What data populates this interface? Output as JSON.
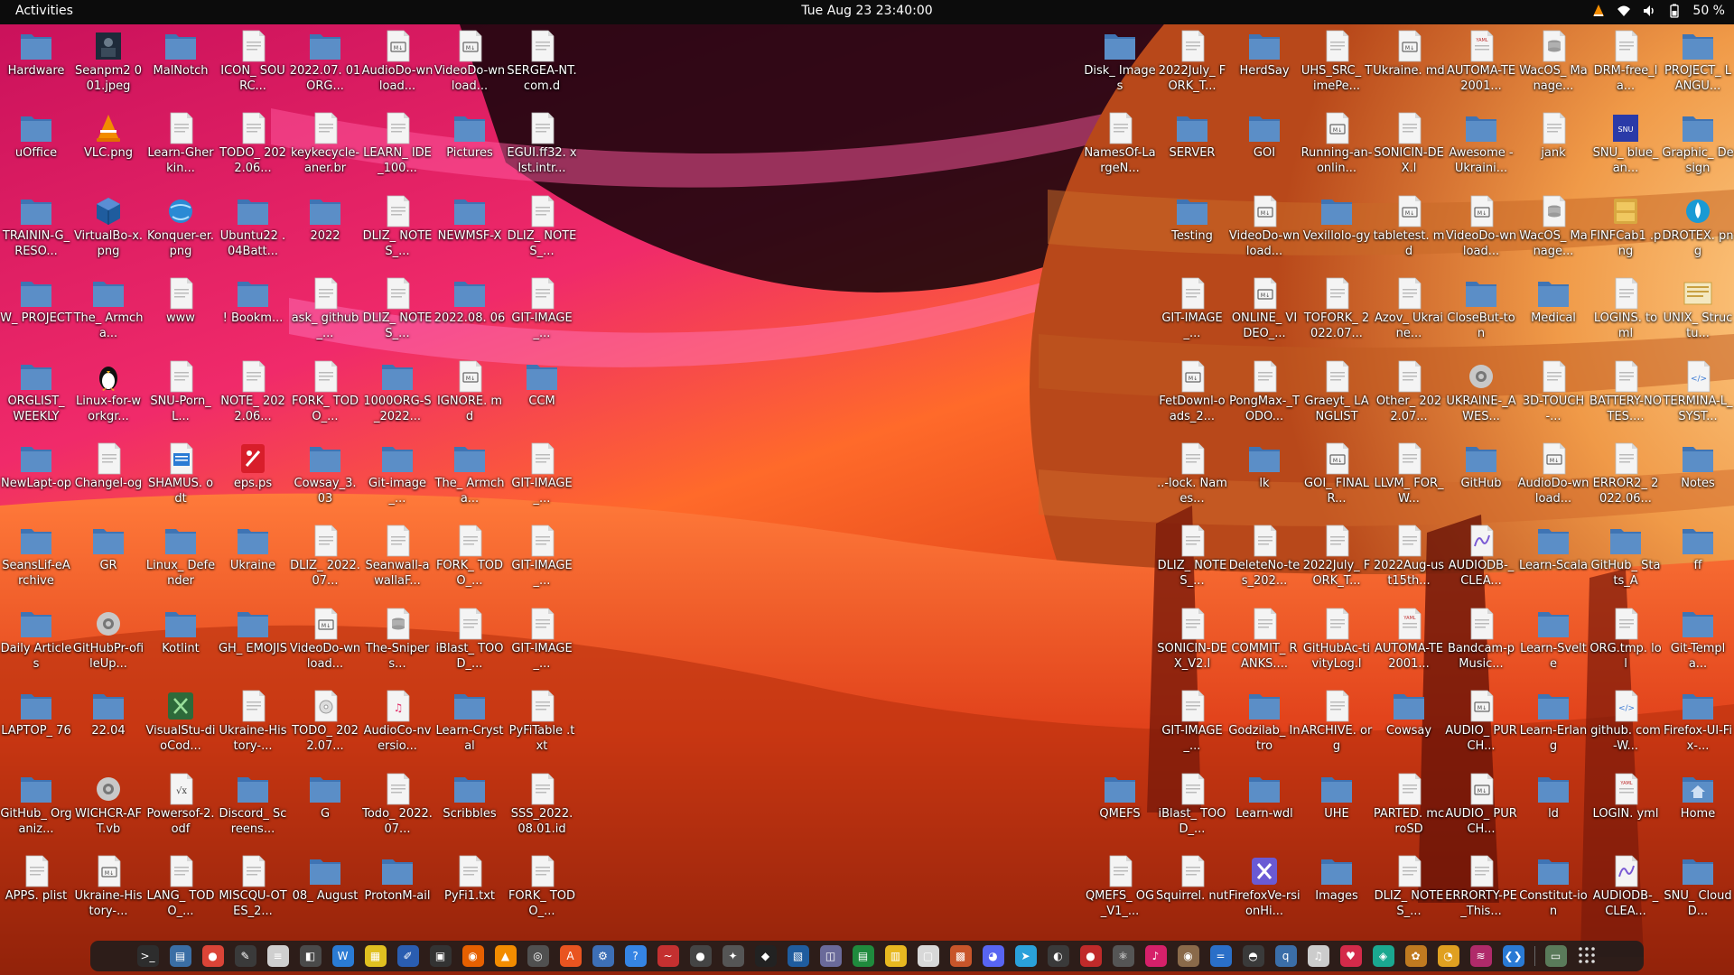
{
  "topbar": {
    "activities": "Activities",
    "clock": "Tue Aug 23  23:40:00",
    "battery": "50 %",
    "icons": [
      "vlc-tray-icon",
      "wifi-icon",
      "volume-icon",
      "battery-icon"
    ]
  },
  "colors": {
    "topbar_bg": "#0c0c0c",
    "folder": "#5b8ec7",
    "file": "#f4f4f4",
    "wallpaper_pink": "#e8146e",
    "wallpaper_orange": "#ff5a14",
    "planet": "#f09a48"
  },
  "left_icons": [
    {
      "label": "Hardware",
      "icon": "folder"
    },
    {
      "label": "uOffice",
      "icon": "folder"
    },
    {
      "label": "TRAININ-G_RESO...",
      "icon": "folder"
    },
    {
      "label": "W_ PROJECT",
      "icon": "folder"
    },
    {
      "label": "ORGLIST_ WEEKLY",
      "icon": "folder"
    },
    {
      "label": "NewLapt-op",
      "icon": "folder"
    },
    {
      "label": "SeansLif-eArchive",
      "icon": "folder"
    },
    {
      "label": "Daily Articles",
      "icon": "folder"
    },
    {
      "label": "LAPTOP_ 76",
      "icon": "folder"
    },
    {
      "label": "GitHub_ Organiz...",
      "icon": "folder"
    },
    {
      "label": "APPS. plist",
      "icon": "file"
    },
    {
      "label": "Seanpm2 001.jpeg",
      "icon": "image"
    },
    {
      "label": "VLC.png",
      "icon": "vlc"
    },
    {
      "label": "VirtualBo-x.png",
      "icon": "cube"
    },
    {
      "label": "The_ Armcha...",
      "icon": "folder"
    },
    {
      "label": "Linux-for-workgr...",
      "icon": "tux"
    },
    {
      "label": "Changel-og",
      "icon": "file"
    },
    {
      "label": "GR",
      "icon": "folder"
    },
    {
      "label": "GitHubPr-ofileUp...",
      "icon": "gear"
    },
    {
      "label": "22.04",
      "icon": "folder"
    },
    {
      "label": "WICHCR-AFT.vb",
      "icon": "gear"
    },
    {
      "label": "Ukraine-History-...",
      "icon": "md"
    },
    {
      "label": "MalNotch",
      "icon": "folder"
    },
    {
      "label": "Learn-Gherkin...",
      "icon": "file"
    },
    {
      "label": "Konquer-er.png",
      "icon": "globe"
    },
    {
      "label": "www",
      "icon": "file"
    },
    {
      "label": "SNU-Porn_L...",
      "icon": "file"
    },
    {
      "label": "SHAMUS. odt",
      "icon": "odt"
    },
    {
      "label": "Linux_ Defender",
      "icon": "folder"
    },
    {
      "label": "Kotlint",
      "icon": "folder"
    },
    {
      "label": "VisualStu-dioCod...",
      "icon": "vscode"
    },
    {
      "label": "Powersof-2.odf",
      "icon": "odf"
    },
    {
      "label": "LANG_ TODO_...",
      "icon": "file"
    },
    {
      "label": "ICON_ SOURC...",
      "icon": "file"
    },
    {
      "label": "TODO_ 2022.06...",
      "icon": "file"
    },
    {
      "label": "Ubuntu22 .04Batt...",
      "icon": "folder"
    },
    {
      "label": "! Bookm...",
      "icon": "folder"
    },
    {
      "label": "NOTE_ 2022.06...",
      "icon": "file"
    },
    {
      "label": "eps.ps",
      "icon": "ps"
    },
    {
      "label": "Ukraine",
      "icon": "folder"
    },
    {
      "label": "GH_ EMOJIS",
      "icon": "folder"
    },
    {
      "label": "Ukraine-History-...",
      "icon": "file"
    },
    {
      "label": "Discord_ Screens...",
      "icon": "folder"
    },
    {
      "label": "MISCQU-OTES_2...",
      "icon": "file"
    },
    {
      "label": "2022.07. 01ORG...",
      "icon": "folder"
    },
    {
      "label": "keykecycle-aner.br",
      "icon": "file"
    },
    {
      "label": "2022",
      "icon": "folder"
    },
    {
      "label": "ask_ github_...",
      "icon": "file"
    },
    {
      "label": "FORK_ TODO_...",
      "icon": "file"
    },
    {
      "label": "Cowsay_3. 03",
      "icon": "folder"
    },
    {
      "label": "DLIZ_ 2022.07...",
      "icon": "file"
    },
    {
      "label": "VideoDo-wnload...",
      "icon": "md"
    },
    {
      "label": "TODO_ 2022.07...",
      "icon": "disc"
    },
    {
      "label": "G",
      "icon": "folder"
    },
    {
      "label": "08_ August",
      "icon": "folder"
    },
    {
      "label": "AudioDo-wnload...",
      "icon": "md"
    },
    {
      "label": "LEARN_ IDE_100...",
      "icon": "file"
    },
    {
      "label": "DLIZ_ NOTES_...",
      "icon": "file"
    },
    {
      "label": "DLIZ_ NOTES_...",
      "icon": "file"
    },
    {
      "label": "1000ORG-S_2022...",
      "icon": "folder"
    },
    {
      "label": "Git-image_...",
      "icon": "folder"
    },
    {
      "label": "Seanwall-awallaF...",
      "icon": "file"
    },
    {
      "label": "The-Snipers...",
      "icon": "db"
    },
    {
      "label": "AudioCo-nversio...",
      "icon": "audio"
    },
    {
      "label": "Todo_ 2022.07...",
      "icon": "file"
    },
    {
      "label": "ProtonM-ail",
      "icon": "folder"
    },
    {
      "label": "VideoDo-wnload...",
      "icon": "md"
    },
    {
      "label": "Pictures",
      "icon": "folder"
    },
    {
      "label": "NEWMSF-X",
      "icon": "folder"
    },
    {
      "label": "2022.08. 06",
      "icon": "folder"
    },
    {
      "label": "IGNORE. md",
      "icon": "md"
    },
    {
      "label": "The_ Armcha...",
      "icon": "folder"
    },
    {
      "label": "FORK_ TODO_...",
      "icon": "file"
    },
    {
      "label": "iBlast_ TOOD_...",
      "icon": "file"
    },
    {
      "label": "Learn-Crystal",
      "icon": "folder"
    },
    {
      "label": "Scribbles",
      "icon": "folder"
    },
    {
      "label": "PyFi1.txt",
      "icon": "file"
    },
    {
      "label": "SERGEA-NT.com.d",
      "icon": "file"
    },
    {
      "label": "EGUI.ff32. xlst.intr...",
      "icon": "file"
    },
    {
      "label": "DLIZ_ NOTES_...",
      "icon": "file"
    },
    {
      "label": "GIT-IMAGE_...",
      "icon": "file"
    },
    {
      "label": "CCM",
      "icon": "folder"
    },
    {
      "label": "GIT-IMAGE_...",
      "icon": "file"
    },
    {
      "label": "GIT-IMAGE_...",
      "icon": "file"
    },
    {
      "label": "GIT-IMAGE_...",
      "icon": "file"
    },
    {
      "label": "PyFiTable .txt",
      "icon": "file"
    },
    {
      "label": "SSS_2022. 08.01.id",
      "icon": "file"
    },
    {
      "label": "FORK_ TODO_...",
      "icon": "file"
    }
  ],
  "right_icons": [
    {
      "label": "Disk_ Images",
      "icon": "folder"
    },
    {
      "label": "NamesOf-LargeN...",
      "icon": "file"
    },
    {
      "label": "",
      "icon": "none"
    },
    {
      "label": "",
      "icon": "none"
    },
    {
      "label": "",
      "icon": "none"
    },
    {
      "label": "",
      "icon": "none"
    },
    {
      "label": "",
      "icon": "none"
    },
    {
      "label": "",
      "icon": "none"
    },
    {
      "label": "",
      "icon": "none"
    },
    {
      "label": "QMEFS",
      "icon": "folder"
    },
    {
      "label": "QMEFS_ OG_V1_...",
      "icon": "file"
    },
    {
      "label": "2022July_ FORK_T...",
      "icon": "file"
    },
    {
      "label": "SERVER",
      "icon": "folder"
    },
    {
      "label": "Testing",
      "icon": "folder"
    },
    {
      "label": "GIT-IMAGE_...",
      "icon": "file"
    },
    {
      "label": "FetDownl-oads_2...",
      "icon": "md"
    },
    {
      "label": "..-lock. Names...",
      "icon": "file"
    },
    {
      "label": "DLIZ_ NOTES_...",
      "icon": "file"
    },
    {
      "label": "SONICIN-DEX_V2.l",
      "icon": "file"
    },
    {
      "label": "GIT-IMAGE_...",
      "icon": "file"
    },
    {
      "label": "iBlast_ TOOD_...",
      "icon": "file"
    },
    {
      "label": "Squirrel. nut",
      "icon": "file"
    },
    {
      "label": "HerdSay",
      "icon": "folder"
    },
    {
      "label": "GOI",
      "icon": "folder"
    },
    {
      "label": "VideoDo-wnload...",
      "icon": "md"
    },
    {
      "label": "ONLINE_ VIDEO_...",
      "icon": "md"
    },
    {
      "label": "PongMax-_TODO...",
      "icon": "file"
    },
    {
      "label": "lk",
      "icon": "folder"
    },
    {
      "label": "DeleteNo-tes_202...",
      "icon": "file"
    },
    {
      "label": "COMMIT_ RANKS....",
      "icon": "file"
    },
    {
      "label": "Godzilab_ Intro",
      "icon": "folder"
    },
    {
      "label": "Learn-wdl",
      "icon": "folder"
    },
    {
      "label": "FirefoxVe-rsionHi...",
      "icon": "xpad"
    },
    {
      "label": "UHS_SRC_ TimePe...",
      "icon": "file"
    },
    {
      "label": "Running-an-onlin...",
      "icon": "md"
    },
    {
      "label": "Vexillolo-gy",
      "icon": "folder"
    },
    {
      "label": "TOFORK_ 2022.07...",
      "icon": "file"
    },
    {
      "label": "Graeyt_ LANGLIST",
      "icon": "file"
    },
    {
      "label": "GOI_ FINALR...",
      "icon": "md"
    },
    {
      "label": "2022July_ FORK_T...",
      "icon": "file"
    },
    {
      "label": "GitHubAc-tivityLog.l",
      "icon": "file"
    },
    {
      "label": "ARCHIVE. org",
      "icon": "file"
    },
    {
      "label": "UHE",
      "icon": "folder"
    },
    {
      "label": "Images",
      "icon": "folder"
    },
    {
      "label": "Ukraine. md",
      "icon": "md"
    },
    {
      "label": "SONICIN-DEX.l",
      "icon": "file"
    },
    {
      "label": "tabletest. md",
      "icon": "md"
    },
    {
      "label": "Azov_ Ukraine...",
      "icon": "file"
    },
    {
      "label": "Other_ 2022.07...",
      "icon": "file"
    },
    {
      "label": "LLVM_ FOR_W...",
      "icon": "file"
    },
    {
      "label": "2022Aug-ust15th...",
      "icon": "file"
    },
    {
      "label": "AUTOMA-TE2001...",
      "icon": "yaml"
    },
    {
      "label": "Cowsay",
      "icon": "folder"
    },
    {
      "label": "PARTED. mcroSD",
      "icon": "file"
    },
    {
      "label": "DLIZ_ NOTES_...",
      "icon": "file"
    },
    {
      "label": "AUTOMA-TE2001...",
      "icon": "yaml"
    },
    {
      "label": "Awesome -Ukraini...",
      "icon": "folder"
    },
    {
      "label": "VideoDo-wnload...",
      "icon": "md"
    },
    {
      "label": "CloseBut-ton",
      "icon": "folder"
    },
    {
      "label": "UKRAINE-_AWES...",
      "icon": "gear"
    },
    {
      "label": "GitHub",
      "icon": "folder"
    },
    {
      "label": "AUDIODB-_CLEA...",
      "icon": "wave"
    },
    {
      "label": "Bandcam-pMusic...",
      "icon": "file"
    },
    {
      "label": "AUDIO_ PURCH...",
      "icon": "md"
    },
    {
      "label": "AUDIO_ PURCH...",
      "icon": "md"
    },
    {
      "label": "ERRORTY-PE_This...",
      "icon": "file"
    },
    {
      "label": "WacOS_ Manage...",
      "icon": "db"
    },
    {
      "label": "jank",
      "icon": "file"
    },
    {
      "label": "WacOS_ Manage...",
      "icon": "db"
    },
    {
      "label": "Medical",
      "icon": "folder"
    },
    {
      "label": "3D-TOUCH-...",
      "icon": "file"
    },
    {
      "label": "AudioDo-wnload...",
      "icon": "md"
    },
    {
      "label": "Learn-Scala",
      "icon": "folder"
    },
    {
      "label": "Learn-Svelte",
      "icon": "folder"
    },
    {
      "label": "Learn-Erlang",
      "icon": "folder"
    },
    {
      "label": "ld",
      "icon": "folder"
    },
    {
      "label": "Constitut-ion",
      "icon": "folder"
    },
    {
      "label": "DRM-free_la...",
      "icon": "file"
    },
    {
      "label": "SNU_ blue_an...",
      "icon": "snu"
    },
    {
      "label": "FINFCab1 .png",
      "icon": "cabinet"
    },
    {
      "label": "LOGINS. toml",
      "icon": "file"
    },
    {
      "label": "BATTERY-NOTES....",
      "icon": "file"
    },
    {
      "label": "ERROR2_ 2022.06...",
      "icon": "file"
    },
    {
      "label": "GitHub_ Stats_A",
      "icon": "folder"
    },
    {
      "label": "ORG.tmp. lol",
      "icon": "file"
    },
    {
      "label": "github. com-W...",
      "icon": "html"
    },
    {
      "label": "LOGIN. yml",
      "icon": "yaml"
    },
    {
      "label": "AUDIODB-_CLEA...",
      "icon": "wave"
    },
    {
      "label": "PROJECT_ LANGU...",
      "icon": "folder"
    },
    {
      "label": "Graphic_ Design",
      "icon": "folder"
    },
    {
      "label": "DROTEX. png",
      "icon": "drop"
    },
    {
      "label": "UNIX_ Structu...",
      "icon": "unix"
    },
    {
      "label": "TERMINA-L_SYST...",
      "icon": "html"
    },
    {
      "label": "Notes",
      "icon": "folder"
    },
    {
      "label": "ff",
      "icon": "folder"
    },
    {
      "label": "Git-Templa...",
      "icon": "folder"
    },
    {
      "label": "Firefox-UI-Fix-...",
      "icon": "folder"
    },
    {
      "label": "Home",
      "icon": "home"
    },
    {
      "label": "SNU_ CloudD...",
      "icon": "folder"
    }
  ],
  "dock": [
    {
      "name": "terminal",
      "color": "#2d2d2d",
      "glyph": ">_"
    },
    {
      "name": "files",
      "color": "#3a6ea5",
      "glyph": "▤"
    },
    {
      "name": "chrome",
      "color": "#db4437",
      "glyph": "●"
    },
    {
      "name": "notes",
      "color": "#3a3a3a",
      "glyph": "✎"
    },
    {
      "name": "text-editor",
      "color": "#cfcfcf",
      "glyph": "≡"
    },
    {
      "name": "screenshot",
      "color": "#4a4a4a",
      "glyph": "◧"
    },
    {
      "name": "writer",
      "color": "#2a7bd4",
      "glyph": "W"
    },
    {
      "name": "calc",
      "color": "#e0c020",
      "glyph": "▦"
    },
    {
      "name": "drawing",
      "color": "#2a5db0",
      "glyph": "✐"
    },
    {
      "name": "console",
      "color": "#333333",
      "glyph": "▣"
    },
    {
      "name": "firefox",
      "color": "#e66000",
      "glyph": "◉"
    },
    {
      "name": "vlc",
      "color": "#f28c00",
      "glyph": "▲"
    },
    {
      "name": "obs",
      "color": "#505050",
      "glyph": "◎"
    },
    {
      "name": "software",
      "color": "#e95420",
      "glyph": "A"
    },
    {
      "name": "settings-app",
      "color": "#3d6fb6",
      "glyph": "⚙"
    },
    {
      "name": "help",
      "color": "#3584e4",
      "glyph": "?"
    },
    {
      "name": "monitor",
      "color": "#c43030",
      "glyph": "~"
    },
    {
      "name": "camera",
      "color": "#444444",
      "glyph": "●"
    },
    {
      "name": "shotwell",
      "color": "#555555",
      "glyph": "✦"
    },
    {
      "name": "inkscape",
      "color": "#222222",
      "glyph": "◆"
    },
    {
      "name": "virtualbox",
      "color": "#1f5c9e",
      "glyph": "▧"
    },
    {
      "name": "boxes",
      "color": "#6a6a9a",
      "glyph": "◫"
    },
    {
      "name": "spreadsheet",
      "color": "#1f8a3d",
      "glyph": "▤"
    },
    {
      "name": "notes-yellow",
      "color": "#e8b820",
      "glyph": "▥"
    },
    {
      "name": "pdf",
      "color": "#d8d8d8",
      "glyph": "▢"
    },
    {
      "name": "archive",
      "color": "#c8552a",
      "glyph": "▩"
    },
    {
      "name": "discord",
      "color": "#5865f2",
      "glyph": "◕"
    },
    {
      "name": "telegram",
      "color": "#2aa1da",
      "glyph": "➤"
    },
    {
      "name": "steam",
      "color": "#3a3a3a",
      "glyph": "◐"
    },
    {
      "name": "recorder",
      "color": "#c02a2a",
      "glyph": "●"
    },
    {
      "name": "blender",
      "color": "#555555",
      "glyph": "⚛"
    },
    {
      "name": "lollypop",
      "color": "#d6206a",
      "glyph": "♪"
    },
    {
      "name": "gimp",
      "color": "#8a6a4a",
      "glyph": "◉"
    },
    {
      "name": "calculator",
      "color": "#2a6fc8",
      "glyph": "="
    },
    {
      "name": "github-desktop",
      "color": "#3a3a3a",
      "glyph": "◓"
    },
    {
      "name": "qbittorrent",
      "color": "#3b6ea8",
      "glyph": "q"
    },
    {
      "name": "music",
      "color": "#cccccc",
      "glyph": "♫"
    },
    {
      "name": "heart-app",
      "color": "#d42a4a",
      "glyph": "♥"
    },
    {
      "name": "teal-app",
      "color": "#1aa890",
      "glyph": "◈"
    },
    {
      "name": "fox-app",
      "color": "#c07a20",
      "glyph": "✿"
    },
    {
      "name": "chat",
      "color": "#e0a020",
      "glyph": "◔"
    },
    {
      "name": "waves",
      "color": "#b02a6a",
      "glyph": "≋"
    },
    {
      "name": "code",
      "color": "#2a7ad4",
      "glyph": "❮❯"
    },
    {
      "name": "trash",
      "color": "#5a7a5a",
      "glyph": "▭"
    }
  ],
  "dock_grid_label": "Show Applications"
}
